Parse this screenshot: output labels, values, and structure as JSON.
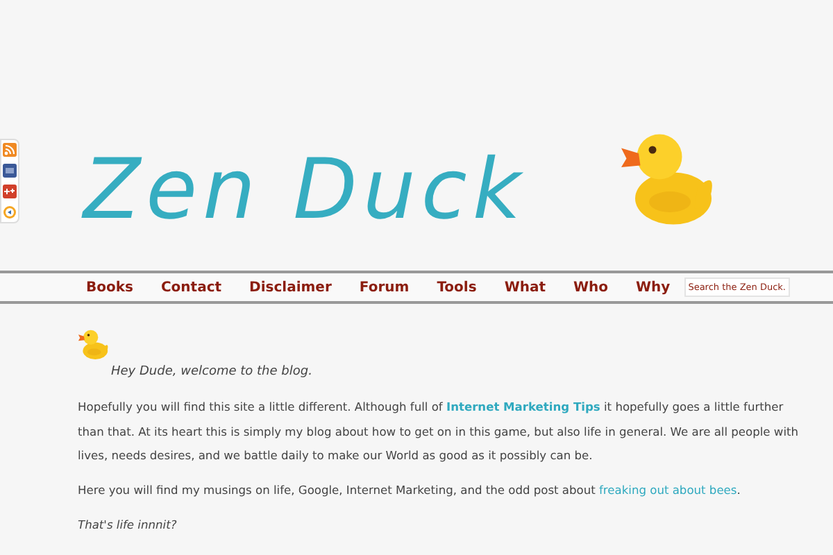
{
  "site": {
    "logo_text": "Zen Duck"
  },
  "nav": {
    "items": [
      {
        "label": "Books"
      },
      {
        "label": "Contact"
      },
      {
        "label": "Disclaimer"
      },
      {
        "label": "Forum"
      },
      {
        "label": "Tools"
      },
      {
        "label": "What"
      },
      {
        "label": "Who"
      },
      {
        "label": "Why"
      }
    ],
    "search": {
      "placeholder": "Search the Zen Duck."
    }
  },
  "post": {
    "greeting": "Hey Dude, welcome to the blog.",
    "paragraphs": [
      {
        "before": "Hopefully you will find this site a little different. Although full of ",
        "link": "Internet Marketing Tips",
        "link_bold": true,
        "after": " it hopefully goes a little further than that. At its heart this is simply my blog about how to get on in this game, but also life in general. We are all people with lives, needs desires, and we battle daily to make our World as good as it possibly can be."
      },
      {
        "before": "Here you will find my musings on life, Google, Internet Marketing, and the odd post about ",
        "link": "freaking out about bees",
        "link_bold": false,
        "after": "."
      }
    ],
    "signoff": "That's life innnit?"
  }
}
